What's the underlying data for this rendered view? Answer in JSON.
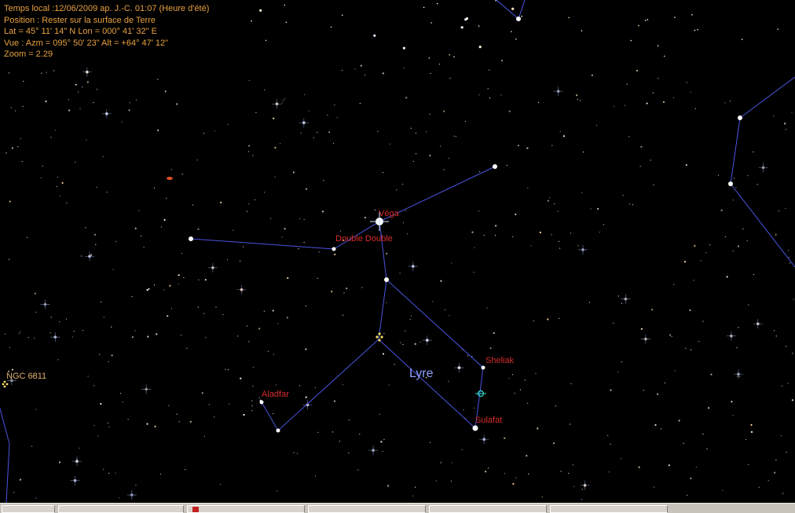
{
  "info": {
    "time": "Temps local :12/06/2009 ap. J.-C. 01:07 (Heure d'été)",
    "position": "Position : Rester sur la surface de Terre",
    "latlon": "Lat = 45° 11' 14\" N Lon = 000° 41' 32\" E",
    "view": "Vue : Azm = 095° 50' 23\" Alt = +64° 47' 12\"",
    "zoom": "Zoom = 2.29"
  },
  "labels": {
    "vega": "Véga",
    "double_double": "Double Double",
    "sheliak": "Sheliak",
    "sulafat": "Sulafat",
    "aladfar": "Aladfar",
    "lyre": "Lyre",
    "ngc6811": "NGC 6811"
  },
  "colors": {
    "background": "#000000",
    "info_text": "#e8a040",
    "star_label": "#d82c2c",
    "constellation_name": "#8fa0ff",
    "constellation_line": "#4650d8"
  }
}
